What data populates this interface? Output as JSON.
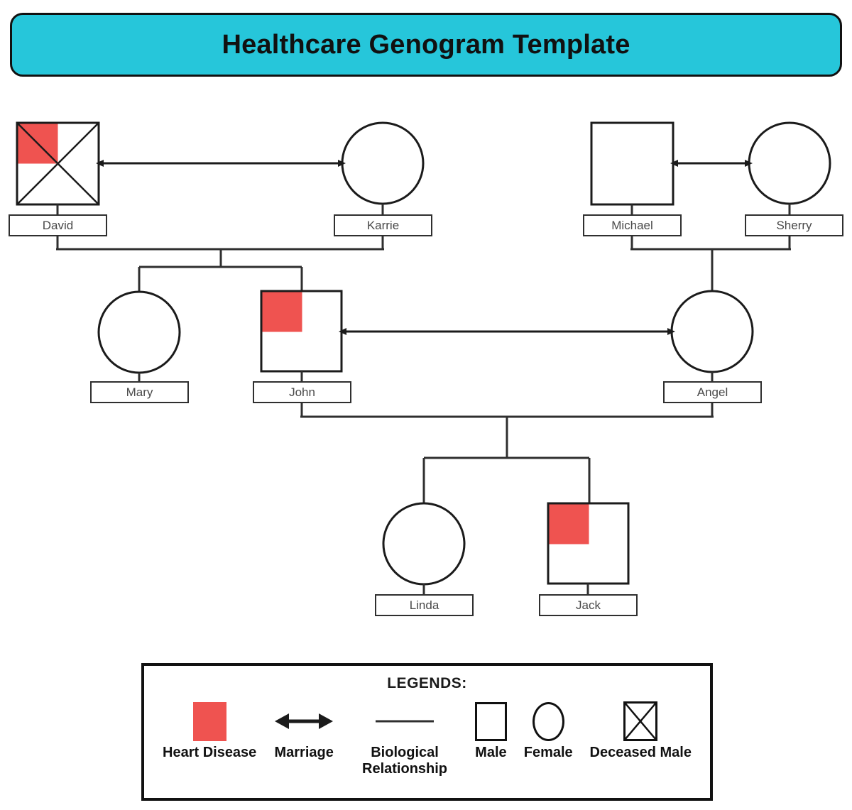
{
  "title": {
    "text": "Healthcare Genogram Template",
    "banner_color": "#26C6DA"
  },
  "colors": {
    "heart_disease": "#EF5350",
    "line": "#1B1B1B",
    "banner": "#26C6DA",
    "label_text": "#494949"
  },
  "genogram": {
    "people": [
      {
        "id": "david",
        "name": "David",
        "gender": "male",
        "shape": "square",
        "deceased": true,
        "heart_disease": true,
        "generation": 1
      },
      {
        "id": "karrie",
        "name": "Karrie",
        "gender": "female",
        "shape": "circle",
        "deceased": false,
        "heart_disease": false,
        "generation": 1
      },
      {
        "id": "michael",
        "name": "Michael",
        "gender": "male",
        "shape": "square",
        "deceased": false,
        "heart_disease": false,
        "generation": 1
      },
      {
        "id": "sherry",
        "name": "Sherry",
        "gender": "female",
        "shape": "circle",
        "deceased": false,
        "heart_disease": false,
        "generation": 1
      },
      {
        "id": "mary",
        "name": "Mary",
        "gender": "female",
        "shape": "circle",
        "deceased": false,
        "heart_disease": false,
        "generation": 2
      },
      {
        "id": "john",
        "name": "John",
        "gender": "male",
        "shape": "square",
        "deceased": false,
        "heart_disease": true,
        "generation": 2
      },
      {
        "id": "angel",
        "name": "Angel",
        "gender": "female",
        "shape": "circle",
        "deceased": false,
        "heart_disease": false,
        "generation": 2
      },
      {
        "id": "linda",
        "name": "Linda",
        "gender": "female",
        "shape": "circle",
        "deceased": false,
        "heart_disease": false,
        "generation": 3
      },
      {
        "id": "jack",
        "name": "Jack",
        "gender": "male",
        "shape": "square",
        "deceased": false,
        "heart_disease": true,
        "generation": 3
      }
    ],
    "marriages": [
      {
        "partners": [
          "david",
          "karrie"
        ],
        "children": [
          "mary",
          "john"
        ]
      },
      {
        "partners": [
          "michael",
          "sherry"
        ],
        "children": [
          "angel"
        ]
      },
      {
        "partners": [
          "john",
          "angel"
        ],
        "children": [
          "linda",
          "jack"
        ]
      }
    ]
  },
  "legend": {
    "title": "LEGENDS:",
    "items": [
      {
        "icon": "heart-disease-swatch",
        "label": "Heart Disease"
      },
      {
        "icon": "marriage-arrow-icon",
        "label": "Marriage"
      },
      {
        "icon": "biological-line-icon",
        "label": "Biological Relationship"
      },
      {
        "icon": "male-square-icon",
        "label": "Male"
      },
      {
        "icon": "female-circle-icon",
        "label": "Female"
      },
      {
        "icon": "deceased-male-icon",
        "label": "Deceased Male"
      }
    ]
  }
}
